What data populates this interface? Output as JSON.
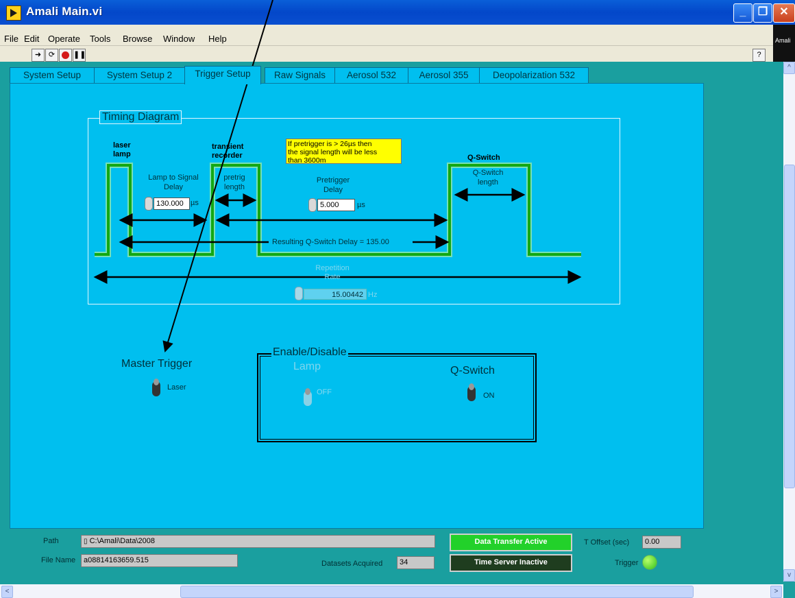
{
  "window": {
    "title": "Amali Main.vi",
    "close_label": "✕",
    "minimize_label": "_",
    "maximize_label": "❐"
  },
  "menu": {
    "items": [
      "File",
      "Edit",
      "Operate",
      "Tools",
      "Browse",
      "Window",
      "Help"
    ]
  },
  "side_logo": {
    "text": "Amali"
  },
  "help_button": "?",
  "tabs": [
    {
      "label": "System Setup",
      "active": false
    },
    {
      "label": "System Setup 2",
      "active": false
    },
    {
      "label": "Trigger Setup",
      "active": true
    },
    {
      "label": "Raw Signals",
      "active": false
    },
    {
      "label": "Aerosol 532",
      "active": false
    },
    {
      "label": "Aerosol 355",
      "active": false
    },
    {
      "label": "Deopolarization 532",
      "active": false
    }
  ],
  "timing": {
    "title": "Timing Diagram",
    "laser_lamp": [
      "laser",
      "lamp"
    ],
    "transient_recorder": [
      "transient",
      "recorder"
    ],
    "qswitch_header": "Q-Switch",
    "note": [
      "If pretrigger is > 26µs then",
      "the signal length will be less",
      "than 3600m"
    ],
    "lamp_to_signal": {
      "label": [
        "Lamp to Signal",
        "Delay"
      ],
      "value": "130.000",
      "unit": "µs"
    },
    "pretrig_length": [
      "pretrig",
      "length"
    ],
    "pretrigger_delay": {
      "label": [
        "Pretrigger",
        "Delay"
      ],
      "value": "5.000",
      "unit": "µs"
    },
    "qswitch_length": [
      "Q-Switch",
      "length"
    ],
    "resulting": "Resulting Q-Switch Delay = 135.00",
    "repetition": {
      "label": [
        "Repetition",
        "Rate"
      ],
      "value": "15.00442",
      "unit": "Hz"
    }
  },
  "master_trigger": {
    "label": "Master Trigger",
    "state": "Laser"
  },
  "enable": {
    "title": "Enable/Disable",
    "lamp": {
      "label": "Lamp",
      "state": "OFF"
    },
    "qswitch": {
      "label": "Q-Switch",
      "state": "ON"
    }
  },
  "status": {
    "path_label": "Path",
    "path_value": "C:\\Amali\\Data\\2008",
    "filename_label": "File Name",
    "filename_value": "a08814163659.515",
    "datasets_label": "Datasets Acquired",
    "datasets_value": "34",
    "data_transfer": "Data Transfer Active",
    "time_server": "Time Server Inactive",
    "toffset_label": "T Offset (sec)",
    "toffset_value": "0.00",
    "trigger_label": "Trigger"
  },
  "colors": {
    "panel": "#00bfef",
    "pulse": "#22c11f",
    "note_bg": "#ffff00",
    "active_btn": "#22d12a",
    "inactive_btn": "#1f3d1f"
  }
}
